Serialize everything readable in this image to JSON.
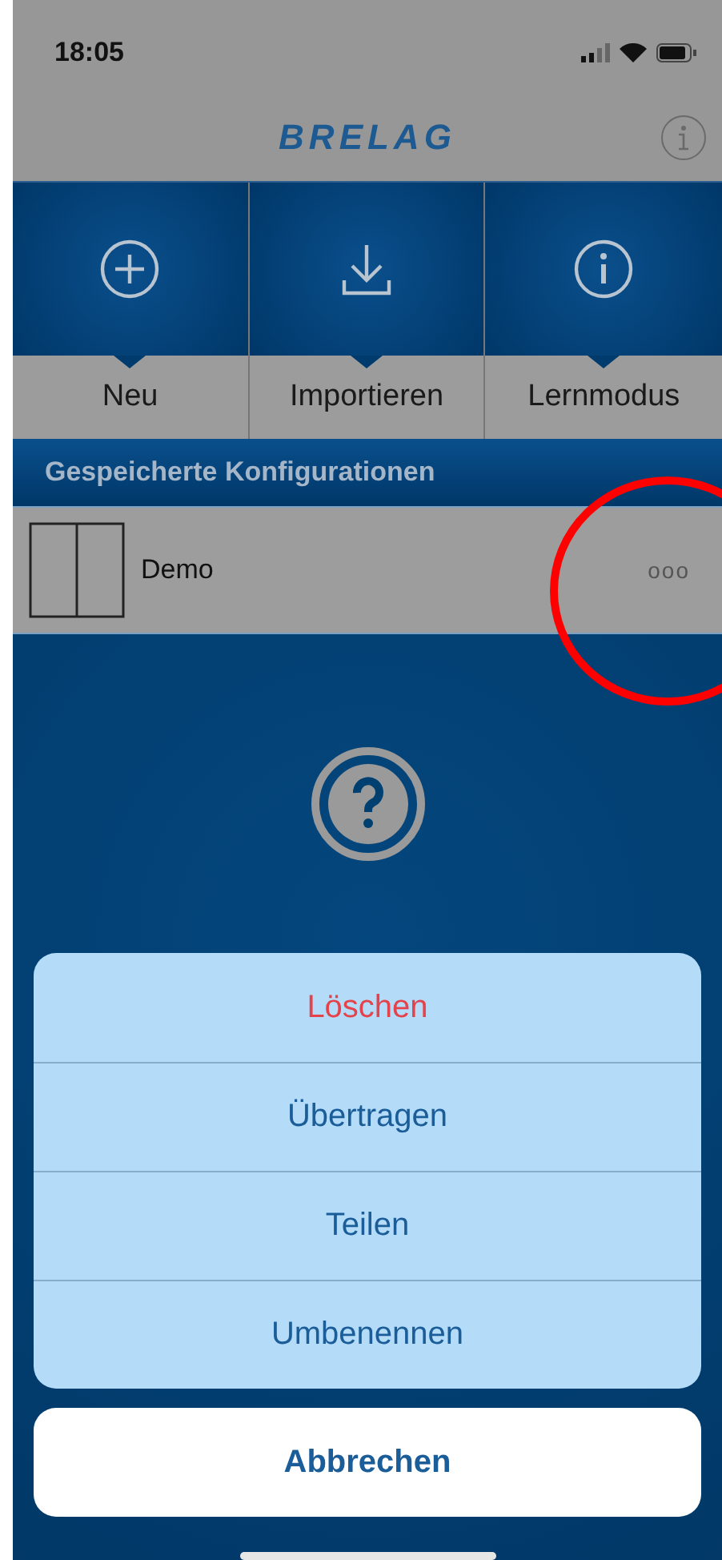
{
  "status_bar": {
    "time": "18:05"
  },
  "nav_bar": {
    "logo": "BRELAG"
  },
  "tiles": [
    {
      "label": "Neu",
      "kind": "plus"
    },
    {
      "label": "Importieren",
      "kind": "download"
    },
    {
      "label": "Lernmodus",
      "kind": "info"
    }
  ],
  "section": {
    "title": "Gespeicherte Konfigurationen"
  },
  "configurations": [
    {
      "name": "Demo",
      "more": "ooo"
    }
  ],
  "action_sheet": {
    "actions": [
      {
        "label": "Löschen",
        "kind": "destructive"
      },
      {
        "label": "Übertragen",
        "kind": "default"
      },
      {
        "label": "Teilen",
        "kind": "default"
      },
      {
        "label": "Umbenennen",
        "kind": "default"
      }
    ],
    "cancel": "Abbrechen"
  }
}
